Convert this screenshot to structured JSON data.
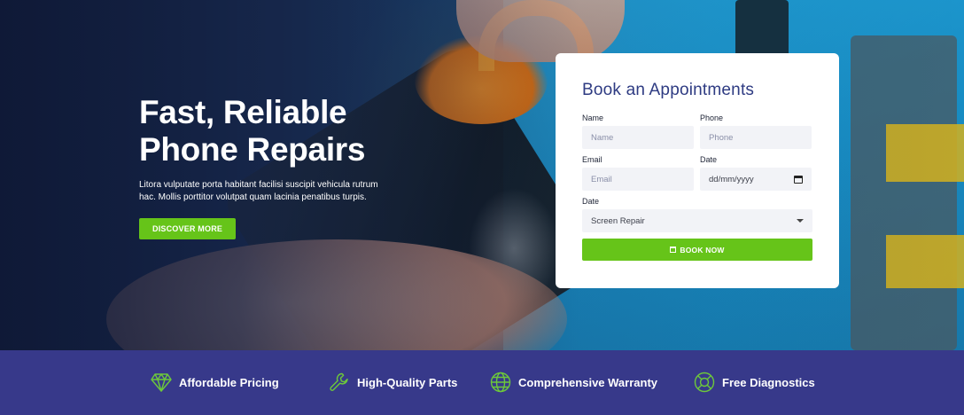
{
  "hero": {
    "title_line1": "Fast, Reliable",
    "title_line2": "Phone Repairs",
    "description": "Litora vulputate porta habitant facilisi suscipit vehicula rutrum hac. Mollis porttitor volutpat quam lacinia penatibus turpis.",
    "cta_label": "DISCOVER MORE"
  },
  "booking": {
    "title": "Book an Appointments",
    "name_label": "Name",
    "name_placeholder": "Name",
    "phone_label": "Phone",
    "phone_placeholder": "Phone",
    "email_label": "Email",
    "email_placeholder": "Email",
    "date_label": "Date",
    "date_placeholder": "dd/mm/yyyy",
    "service_label": "Date",
    "service_selected": "Screen Repair",
    "submit_label": "BOOK NOW"
  },
  "features": [
    {
      "label": "Affordable Pricing",
      "icon": "diamond-icon"
    },
    {
      "label": "High-Quality Parts",
      "icon": "wrench-icon"
    },
    {
      "label": "Comprehensive Warranty",
      "icon": "globe-icon"
    },
    {
      "label": "Free Diagnostics",
      "icon": "lifebuoy-icon"
    }
  ],
  "colors": {
    "accent_green": "#66c419",
    "brand_indigo": "#37398a",
    "card_title": "#2e3b82",
    "feature_icon": "#6dc93a"
  }
}
